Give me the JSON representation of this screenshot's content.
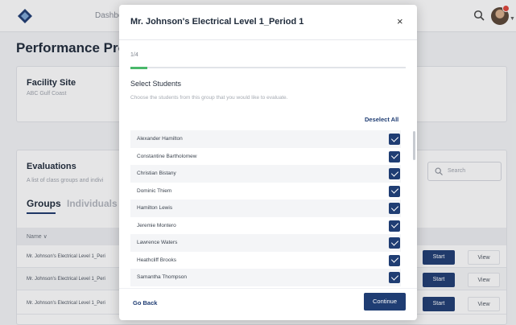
{
  "topbar": {
    "nav_dashboard": "Dashboa"
  },
  "page": {
    "title": "Performance Profile"
  },
  "facility": {
    "title": "Facility Site",
    "value": "ABC Gulf Coast"
  },
  "evaluations": {
    "title": "Evaluations",
    "subtitle": "A list of class groups and indivi",
    "tabs": [
      "Groups",
      "Individuals"
    ],
    "search_placeholder": "Search",
    "column_name": "Name ∨",
    "rows": [
      {
        "name": "Mr. Johnson's Electrical Level 1_Peri",
        "start": "Start",
        "view": "View"
      },
      {
        "name": "Mr. Johnson's Electrical Level 1_Peri",
        "start": "Start",
        "view": "View"
      },
      {
        "name": "Mr. Johnson's Electrical Level 1_Peri",
        "start": "Start",
        "view": "View"
      }
    ]
  },
  "modal": {
    "title": "Mr. Johnson's Electrical Level 1_Period 1",
    "close": "×",
    "step": "1/4",
    "progress": 0.0625,
    "section_title": "Select Students",
    "section_desc": "Choose the students from this group that you would like to evaluate.",
    "deselect_all": "Deselect All",
    "students": [
      {
        "name": "Alexander Hamilton",
        "checked": true
      },
      {
        "name": "Constantine Bartholomew",
        "checked": true
      },
      {
        "name": "Christian Bistany",
        "checked": true
      },
      {
        "name": "Dominic Thiem",
        "checked": true
      },
      {
        "name": "Hamilton Lewis",
        "checked": true
      },
      {
        "name": "Jeremie Montero",
        "checked": true
      },
      {
        "name": "Lawrence Waters",
        "checked": true
      },
      {
        "name": "Heathcliff Brooks",
        "checked": true
      },
      {
        "name": "Samantha Thompson",
        "checked": true
      }
    ],
    "go_back": "Go Back",
    "continue": "Continue"
  },
  "colors": {
    "primary": "#1f3d73",
    "progress": "#49b86a",
    "notification": "#e0453a"
  },
  "icons": {
    "logo": "diamond-logo-icon",
    "search": "search-icon",
    "close": "close-icon",
    "checkbox": "checkbox-checked-icon"
  }
}
